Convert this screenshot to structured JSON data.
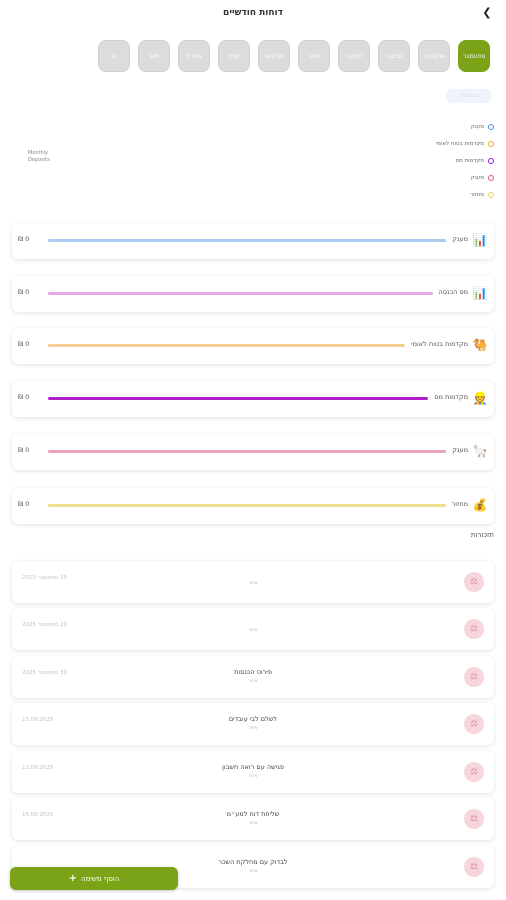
{
  "header": {
    "title": "דוחות חודשיים",
    "back_icon": "chevron-left-icon"
  },
  "months": [
    {
      "label": "ספטמבר",
      "active": true
    },
    {
      "label": "אוקטובר",
      "active": false
    },
    {
      "label": "נובמבר",
      "active": false
    },
    {
      "label": "דצמבר",
      "active": false
    },
    {
      "label": "ינואר",
      "active": false
    },
    {
      "label": "פברואר",
      "active": false
    },
    {
      "label": "מרץ",
      "active": false
    },
    {
      "label": "אפריל",
      "active": false
    },
    {
      "label": "מאי",
      "active": false
    },
    {
      "label": "יוני",
      "active": false
    }
  ],
  "chip_label": "הצג הכל",
  "legend": [
    {
      "label": "מענק",
      "color": "#4a90e2"
    },
    {
      "label": "מקדמות בטוח לאומי",
      "color": "#f5a623"
    },
    {
      "label": "מקדמות מס",
      "color": "#9013fe"
    },
    {
      "label": "מענק",
      "color": "#e2577c"
    },
    {
      "label": "מחזור",
      "color": "#e8d84a"
    }
  ],
  "yaxis_label": "Monthly Deposits",
  "categories": [
    {
      "label": "מענק",
      "amount": "0 ₪",
      "color": "#a9cdf2",
      "icon": "bar-chart-icon",
      "glyph": "📊"
    },
    {
      "label": "מס הכנסה",
      "amount": "0 ₪",
      "color": "#e6a7e8",
      "icon": "bar-chart-icon",
      "glyph": "📊"
    },
    {
      "label": "מקדמות בטוח לאומי",
      "amount": "0 ₪",
      "color": "#f5cd95",
      "icon": "camel-icon",
      "glyph": "🐫"
    },
    {
      "label": "מקדמות מס",
      "amount": "0 ₪",
      "color": "#b020c8",
      "icon": "worker-icon",
      "glyph": "👷"
    },
    {
      "label": "מענק",
      "amount": "0 ₪",
      "color": "#eaa4b6",
      "icon": "llama-icon",
      "glyph": "🦙"
    },
    {
      "label": "מחזור",
      "amount": "0 ₪",
      "color": "#eee08e",
      "icon": "cash-icon",
      "glyph": "💰"
    }
  ],
  "tasks_title": "תזכורות",
  "tasks": [
    {
      "title": "",
      "subtitle": "אחר",
      "date": "15 ספטמבר 2025"
    },
    {
      "title": "",
      "subtitle": "אחר",
      "date": "20 ספטמבר 2025"
    },
    {
      "title": "פירוט הכנסות",
      "subtitle": "אחר",
      "date": "30 ספטמבר 2025"
    },
    {
      "title": "לשלם לבי עובדים",
      "subtitle": "אחר",
      "date": "15.09.2025"
    },
    {
      "title": "פגישה עם רואה חשבון",
      "subtitle": "אחר",
      "date": "12.09.2025"
    },
    {
      "title": "שליחת דוח למע״מ",
      "subtitle": "אחר",
      "date": "15.09.2025"
    },
    {
      "title": "לבדוק עם מחלקת השכר",
      "subtitle": "אחר",
      "date": ""
    }
  ],
  "add_task_label": "הוסף משימה",
  "colors": {
    "accent": "#7aa318"
  }
}
